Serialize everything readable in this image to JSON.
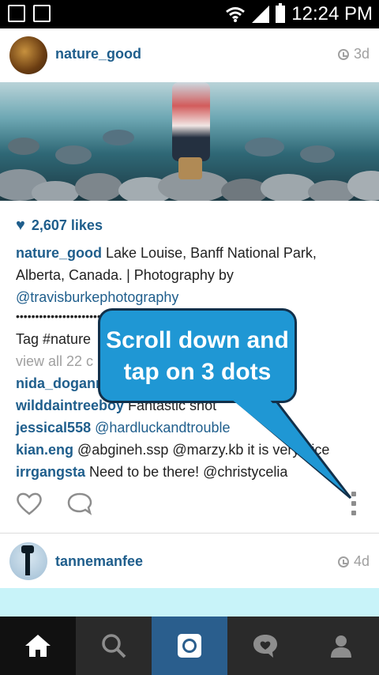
{
  "status_bar": {
    "time": "12:24 PM"
  },
  "post1": {
    "username": "nature_good",
    "time": "3d",
    "likes": "2,607 likes",
    "caption_user": "nature_good",
    "caption_text": " Lake Louise, Banff National Park, Alberta, Canada. | Photography by ",
    "caption_mention": "@travisburkephotography",
    "dots": "••••••••••••••••••••••••••••",
    "tag_line": "Tag #nature",
    "view_all": "view all 22 c",
    "comments": [
      {
        "user": "nida_dogann",
        "text": ""
      },
      {
        "user": "wilddaintreeboy",
        "text": " Fantastic shot"
      },
      {
        "user": "jessical558",
        "text": " @hardluckandtrouble"
      },
      {
        "user": "kian.eng",
        "text": " @abgineh.ssp @marzy.kb  it is very nice"
      },
      {
        "user": "irrgangsta",
        "text": " Need to be there! @christycelia"
      }
    ]
  },
  "post2": {
    "username": "tannemanfee",
    "time": "4d"
  },
  "tooltip": {
    "text": "Scroll down and tap on 3 dots"
  },
  "tabs": [
    "home-icon",
    "search-icon",
    "camera-icon",
    "activity-icon",
    "profile-icon"
  ],
  "colors": {
    "accent": "#1f5e8c",
    "tooltip": "#1f97d4",
    "camera_tab": "#2a5e8d"
  }
}
